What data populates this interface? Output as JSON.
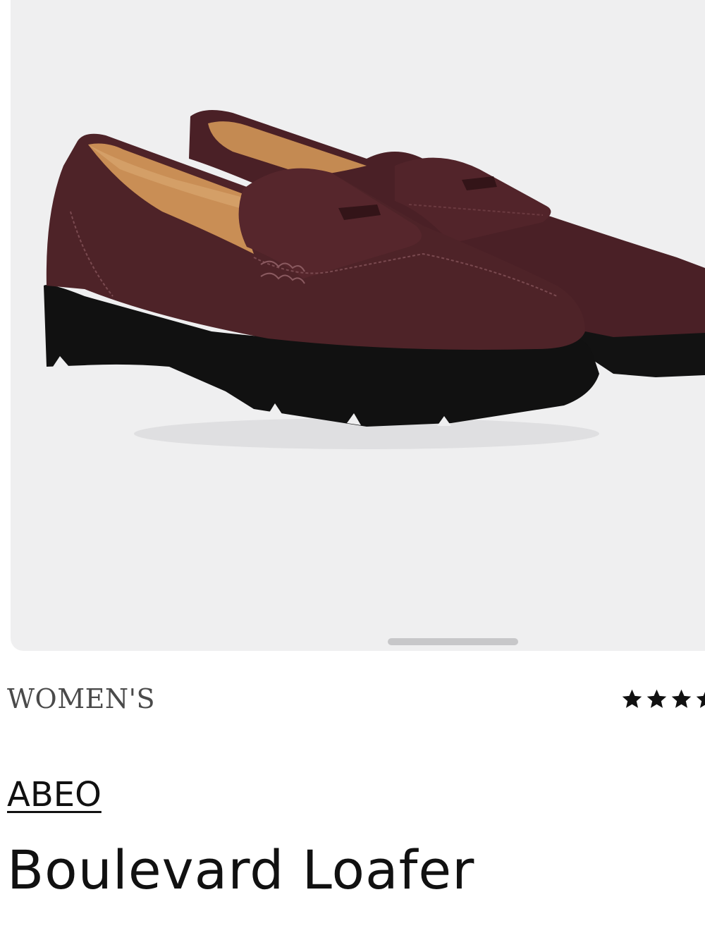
{
  "product": {
    "category": "WOMEN'S",
    "brand": "ABEO",
    "name": "Boulevard Loafer",
    "image_alt": "Boulevard Loafer in brown suede with black lug sole",
    "rating": {
      "stars_visible": 3.5,
      "icon": "star-icon"
    }
  },
  "colors": {
    "gallery_bg": "#efeff0",
    "suede": "#4e2328",
    "sole": "#111111",
    "lining": "#c98e55"
  }
}
